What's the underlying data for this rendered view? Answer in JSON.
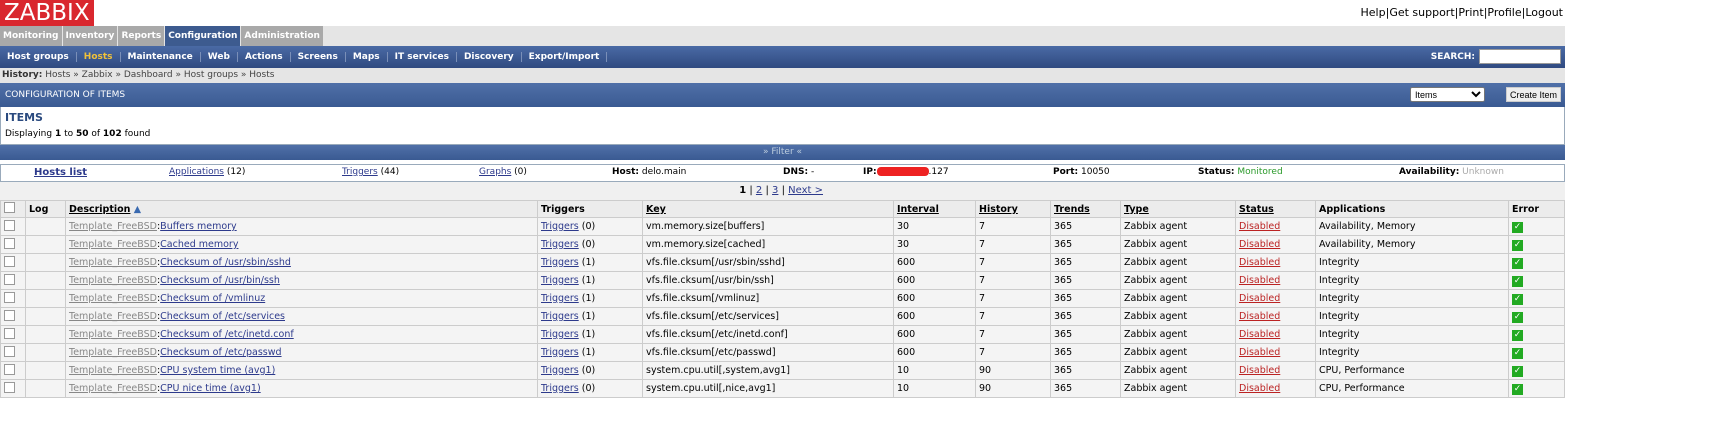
{
  "app": {
    "logo": "ZABBIX"
  },
  "toplinks": [
    "Help",
    "Get support",
    "Print",
    "Profile",
    "Logout"
  ],
  "mainmenu": [
    "Monitoring",
    "Inventory",
    "Reports",
    "Configuration",
    "Administration"
  ],
  "submenu": [
    "Host groups",
    "Hosts",
    "Maintenance",
    "Web",
    "Actions",
    "Screens",
    "Maps",
    "IT services",
    "Discovery",
    "Export/Import"
  ],
  "search_label": "SEARCH:",
  "history": {
    "label": "History:",
    "path": "Hosts » Zabbix » Dashboard » Host groups » Hosts"
  },
  "header": {
    "title": "CONFIGURATION OF ITEMS",
    "select": "Items",
    "create": "Create Item"
  },
  "items": {
    "title": "ITEMS",
    "disp_pre": "Displaying ",
    "from": "1",
    "to_label": " to ",
    "to": "50",
    "of_label": " of ",
    "total": "102",
    "found": " found"
  },
  "filter": "» Filter «",
  "hostbar": {
    "hosts_list": "Hosts list",
    "applications": "Applications",
    "app_count": "(12)",
    "triggers": "Triggers",
    "trig_count": "(44)",
    "graphs": "Graphs",
    "graph_count": "(0)",
    "host_label": "Host:",
    "host": "delo.main",
    "dns_label": "DNS:",
    "dns": "-",
    "ip_label": "IP:",
    "ip_suffix": ".127",
    "port_label": "Port:",
    "port": "10050",
    "status_label": "Status:",
    "status": "Monitored",
    "avail_label": "Availability:",
    "avail": "Unknown",
    "status_color": "#2a9a2a"
  },
  "pager": {
    "current": "1",
    "pages": [
      "2",
      "3"
    ],
    "next": "Next >"
  },
  "columns": [
    "Log",
    "Description",
    "Triggers",
    "Key",
    "Interval",
    "History",
    "Trends",
    "Type",
    "Status",
    "Applications",
    "Error"
  ],
  "rows": [
    {
      "tmpl": "Template_FreeBSD",
      "name": "Buffers memory",
      "trig": "(0)",
      "key": "vm.memory.size[buffers]",
      "interval": "30",
      "history": "7",
      "trends": "365",
      "type": "Zabbix agent",
      "status": "Disabled",
      "apps": "Availability, Memory"
    },
    {
      "tmpl": "Template_FreeBSD",
      "name": "Cached memory",
      "trig": "(0)",
      "key": "vm.memory.size[cached]",
      "interval": "30",
      "history": "7",
      "trends": "365",
      "type": "Zabbix agent",
      "status": "Disabled",
      "apps": "Availability, Memory"
    },
    {
      "tmpl": "Template_FreeBSD",
      "name": "Checksum of /usr/sbin/sshd",
      "trig": "(1)",
      "key": "vfs.file.cksum[/usr/sbin/sshd]",
      "interval": "600",
      "history": "7",
      "trends": "365",
      "type": "Zabbix agent",
      "status": "Disabled",
      "apps": "Integrity"
    },
    {
      "tmpl": "Template_FreeBSD",
      "name": "Checksum of /usr/bin/ssh",
      "trig": "(1)",
      "key": "vfs.file.cksum[/usr/bin/ssh]",
      "interval": "600",
      "history": "7",
      "trends": "365",
      "type": "Zabbix agent",
      "status": "Disabled",
      "apps": "Integrity"
    },
    {
      "tmpl": "Template_FreeBSD",
      "name": "Checksum of /vmlinuz",
      "trig": "(1)",
      "key": "vfs.file.cksum[/vmlinuz]",
      "interval": "600",
      "history": "7",
      "trends": "365",
      "type": "Zabbix agent",
      "status": "Disabled",
      "apps": "Integrity"
    },
    {
      "tmpl": "Template_FreeBSD",
      "name": "Checksum of /etc/services",
      "trig": "(1)",
      "key": "vfs.file.cksum[/etc/services]",
      "interval": "600",
      "history": "7",
      "trends": "365",
      "type": "Zabbix agent",
      "status": "Disabled",
      "apps": "Integrity"
    },
    {
      "tmpl": "Template_FreeBSD",
      "name": "Checksum of /etc/inetd.conf",
      "trig": "(1)",
      "key": "vfs.file.cksum[/etc/inetd.conf]",
      "interval": "600",
      "history": "7",
      "trends": "365",
      "type": "Zabbix agent",
      "status": "Disabled",
      "apps": "Integrity"
    },
    {
      "tmpl": "Template_FreeBSD",
      "name": "Checksum of /etc/passwd",
      "trig": "(1)",
      "key": "vfs.file.cksum[/etc/passwd]",
      "interval": "600",
      "history": "7",
      "trends": "365",
      "type": "Zabbix agent",
      "status": "Disabled",
      "apps": "Integrity"
    },
    {
      "tmpl": "Template_FreeBSD",
      "name": "CPU system time (avg1)",
      "trig": "(0)",
      "key": "system.cpu.util[,system,avg1]",
      "interval": "10",
      "history": "90",
      "trends": "365",
      "type": "Zabbix agent",
      "status": "Disabled",
      "apps": "CPU, Performance"
    },
    {
      "tmpl": "Template_FreeBSD",
      "name": "CPU nice time (avg1)",
      "trig": "(0)",
      "key": "system.cpu.util[,nice,avg1]",
      "interval": "10",
      "history": "90",
      "trends": "365",
      "type": "Zabbix agent",
      "status": "Disabled",
      "apps": "CPU, Performance"
    }
  ],
  "triggers_link": "Triggers",
  "error_icon": "check-icon"
}
